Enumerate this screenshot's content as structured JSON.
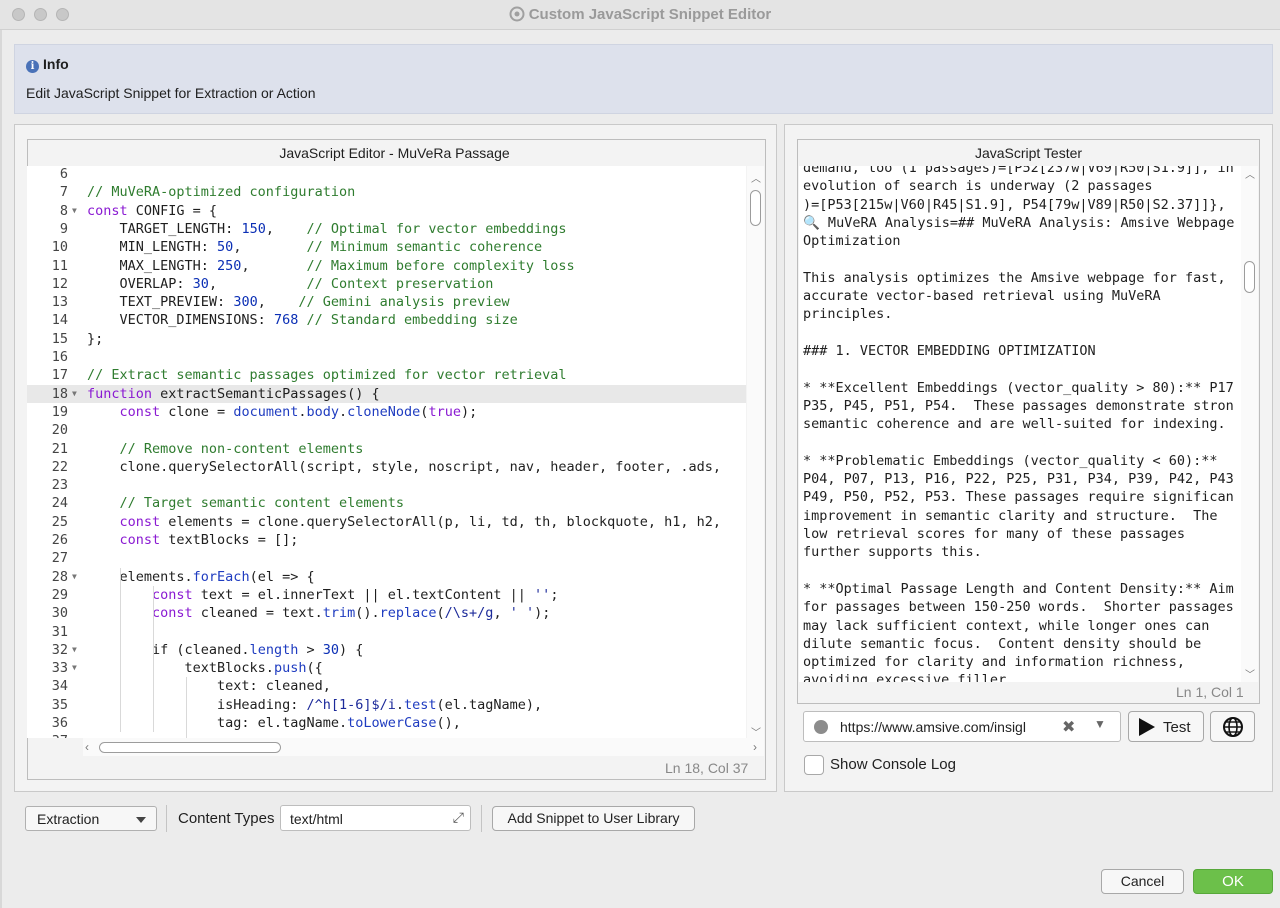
{
  "window": {
    "title": "Custom JavaScript Snippet Editor"
  },
  "info": {
    "heading": "Info",
    "message": "Edit JavaScript Snippet for Extraction or Action"
  },
  "editor": {
    "title": "JavaScript Editor - MuVeRa Passage",
    "status": "Ln 18, Col 37",
    "lines": [
      {
        "n": "6",
        "t": ""
      },
      {
        "n": "7",
        "t": "// MuVeRA-optimized configuration"
      },
      {
        "n": "8",
        "t": "const CONFIG = {",
        "fold": true
      },
      {
        "n": "9",
        "t": "    TARGET_LENGTH: 150,    // Optimal for vector embeddings"
      },
      {
        "n": "10",
        "t": "    MIN_LENGTH: 50,        // Minimum semantic coherence"
      },
      {
        "n": "11",
        "t": "    MAX_LENGTH: 250,       // Maximum before complexity loss"
      },
      {
        "n": "12",
        "t": "    OVERLAP: 30,           // Context preservation"
      },
      {
        "n": "13",
        "t": "    TEXT_PREVIEW: 300,    // Gemini analysis preview"
      },
      {
        "n": "14",
        "t": "    VECTOR_DIMENSIONS: 768 // Standard embedding size"
      },
      {
        "n": "15",
        "t": "};"
      },
      {
        "n": "16",
        "t": ""
      },
      {
        "n": "17",
        "t": "// Extract semantic passages optimized for vector retrieval"
      },
      {
        "n": "18",
        "t": "function extractSemanticPassages() {",
        "fold": true
      },
      {
        "n": "19",
        "t": "    const clone = document.body.cloneNode(true);"
      },
      {
        "n": "20",
        "t": ""
      },
      {
        "n": "21",
        "t": "    // Remove non-content elements"
      },
      {
        "n": "22",
        "t": "    clone.querySelectorAll('script, style, noscript, nav, header, footer, .ads,"
      },
      {
        "n": "23",
        "t": ""
      },
      {
        "n": "24",
        "t": "    // Target semantic content elements"
      },
      {
        "n": "25",
        "t": "    const elements = clone.querySelectorAll('p, li, td, th, blockquote, h1, h2,"
      },
      {
        "n": "26",
        "t": "    const textBlocks = [];"
      },
      {
        "n": "27",
        "t": ""
      },
      {
        "n": "28",
        "t": "    elements.forEach(el => {",
        "fold": true
      },
      {
        "n": "29",
        "t": "        const text = el.innerText || el.textContent || '';"
      },
      {
        "n": "30",
        "t": "        const cleaned = text.trim().replace(/\\s+/g, ' ');"
      },
      {
        "n": "31",
        "t": ""
      },
      {
        "n": "32",
        "t": "        if (cleaned.length > 30) {",
        "fold": true
      },
      {
        "n": "33",
        "t": "            textBlocks.push({",
        "fold": true
      },
      {
        "n": "34",
        "t": "                text: cleaned,"
      },
      {
        "n": "35",
        "t": "                isHeading: /^h[1-6]$/i.test(el.tagName),"
      },
      {
        "n": "36",
        "t": "                tag: el.tagName.toLowerCase(),"
      },
      {
        "n": "37",
        "t": ""
      }
    ]
  },
  "tester": {
    "title": "JavaScript Tester",
    "status": "Ln 1, Col 1",
    "output": [
      "demand, too (1 passages)=[P52[237w|V69|R50|S1.9]], in",
      "evolution of search is underway (2 passages",
      ")=[P53[215w|V60|R45|S1.9], P54[79w|V89|R50|S2.37]]},",
      "🔍 MuVeRA Analysis=## MuVeRA Analysis: Amsive Webpage",
      "Optimization",
      "",
      "This analysis optimizes the Amsive webpage for fast,",
      "accurate vector-based retrieval using MuVeRA",
      "principles.",
      "",
      "### 1. VECTOR EMBEDDING OPTIMIZATION",
      "",
      "* **Excellent Embeddings (vector_quality > 80):** P17",
      "P35, P45, P51, P54.  These passages demonstrate stron",
      "semantic coherence and are well-suited for indexing.",
      "",
      "* **Problematic Embeddings (vector_quality < 60):**",
      "P04, P07, P13, P16, P22, P25, P31, P34, P39, P42, P43",
      "P49, P50, P52, P53. These passages require significan",
      "improvement in semantic clarity and structure.  The",
      "low retrieval scores for many of these passages",
      "further supports this.",
      "",
      "* **Optimal Passage Length and Content Density:** Aim",
      "for passages between 150-250 words.  Shorter passages",
      "may lack sufficient context, while longer ones can",
      "dilute semantic focus.  Content density should be",
      "optimized for clarity and information richness,",
      "avoiding excessive filler"
    ],
    "url": "https://www.amsive.com/insigl",
    "test_label": "Test",
    "console_label": "Show Console Log"
  },
  "toolbar": {
    "type_value": "Extraction",
    "content_types_label": "Content Types",
    "content_types_value": "text/html",
    "add_library_label": "Add Snippet to User Library"
  },
  "dialog": {
    "cancel_label": "Cancel",
    "ok_label": "OK"
  },
  "colors": {
    "ok": "#6cc04a",
    "info_bg": "#dde1ec",
    "keyword": "#8a1ad2",
    "comment": "#2f7c2f",
    "number": "#0b2fb5"
  }
}
